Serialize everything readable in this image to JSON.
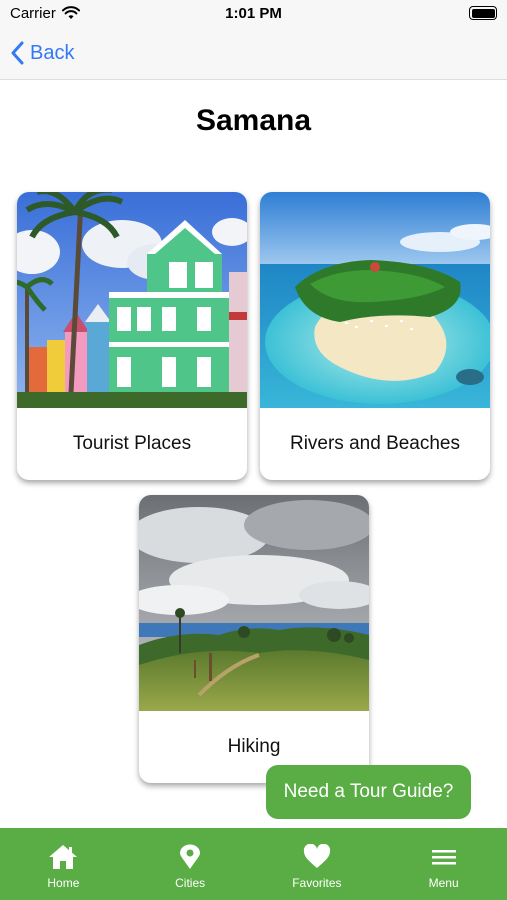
{
  "status_bar": {
    "carrier": "Carrier",
    "time": "1:01 PM"
  },
  "nav": {
    "back_label": "Back"
  },
  "page": {
    "title": "Samana"
  },
  "cards": [
    {
      "label": "Tourist Places",
      "image": "colorful-houses-photo"
    },
    {
      "label": "Rivers and Beaches",
      "image": "tropical-island-photo"
    },
    {
      "label": "Hiking",
      "image": "green-hills-photo"
    }
  ],
  "tour_button": {
    "label": "Need a Tour Guide?"
  },
  "tabs": [
    {
      "label": "Home",
      "icon": "home-icon"
    },
    {
      "label": "Cities",
      "icon": "location-pin-icon"
    },
    {
      "label": "Favorites",
      "icon": "heart-icon"
    },
    {
      "label": "Menu",
      "icon": "hamburger-menu-icon"
    }
  ],
  "colors": {
    "accent_green": "#5aad44",
    "ios_blue": "#3478f6"
  }
}
